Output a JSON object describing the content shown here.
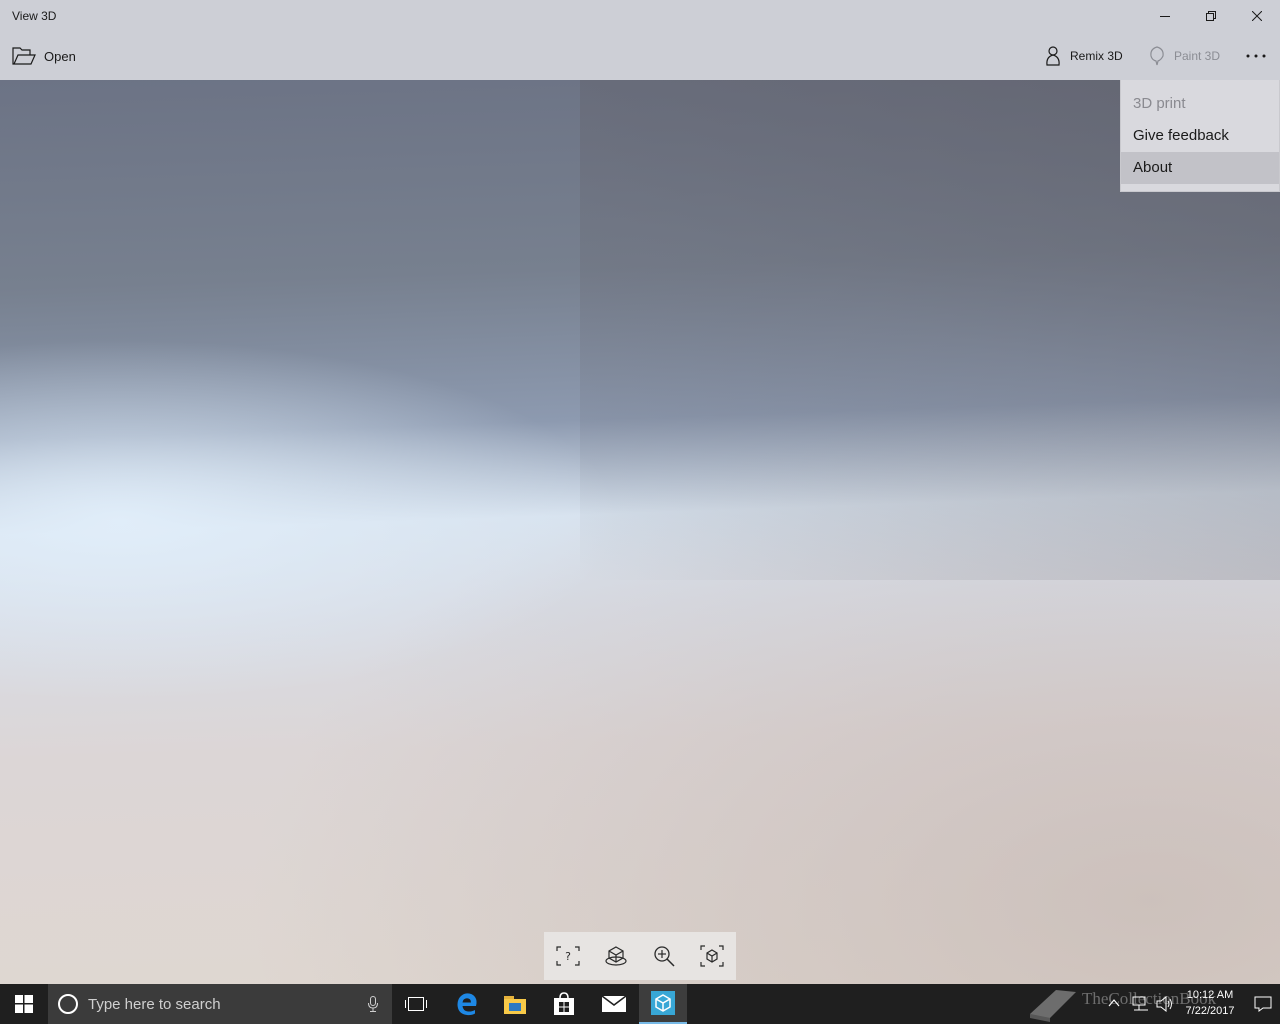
{
  "window": {
    "title": "View 3D"
  },
  "toolbar": {
    "open_label": "Open",
    "remix_label": "Remix 3D",
    "paint_label": "Paint 3D"
  },
  "overflow_menu": {
    "items": [
      {
        "label": "3D print",
        "disabled": true
      },
      {
        "label": "Give feedback",
        "disabled": false
      },
      {
        "label": "About",
        "disabled": false,
        "hovered": true
      }
    ]
  },
  "view_tools": {
    "icons": [
      "mixed-reality-icon",
      "environment-icon",
      "zoom-icon",
      "reset-view-icon"
    ]
  },
  "taskbar": {
    "search_placeholder": "Type here to search",
    "clock_time": "10:12 AM",
    "clock_date": "7/22/2017",
    "watermark": "TheCollectionBook",
    "active_app_accent": "#77b9e6"
  }
}
